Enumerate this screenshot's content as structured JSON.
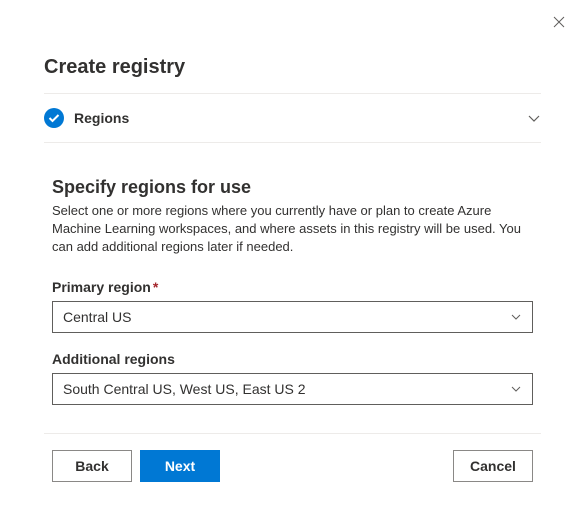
{
  "title": "Create registry",
  "section": {
    "label": "Regions"
  },
  "content": {
    "heading": "Specify regions for use",
    "description": "Select one or more regions where you currently have or plan to create Azure Machine Learning workspaces, and where assets in this registry will be used. You can add additional regions later if needed.",
    "primary_label": "Primary region",
    "primary_value": "Central US",
    "additional_label": "Additional regions",
    "additional_value": "South Central US, West US, East US 2"
  },
  "footer": {
    "back": "Back",
    "next": "Next",
    "cancel": "Cancel"
  }
}
